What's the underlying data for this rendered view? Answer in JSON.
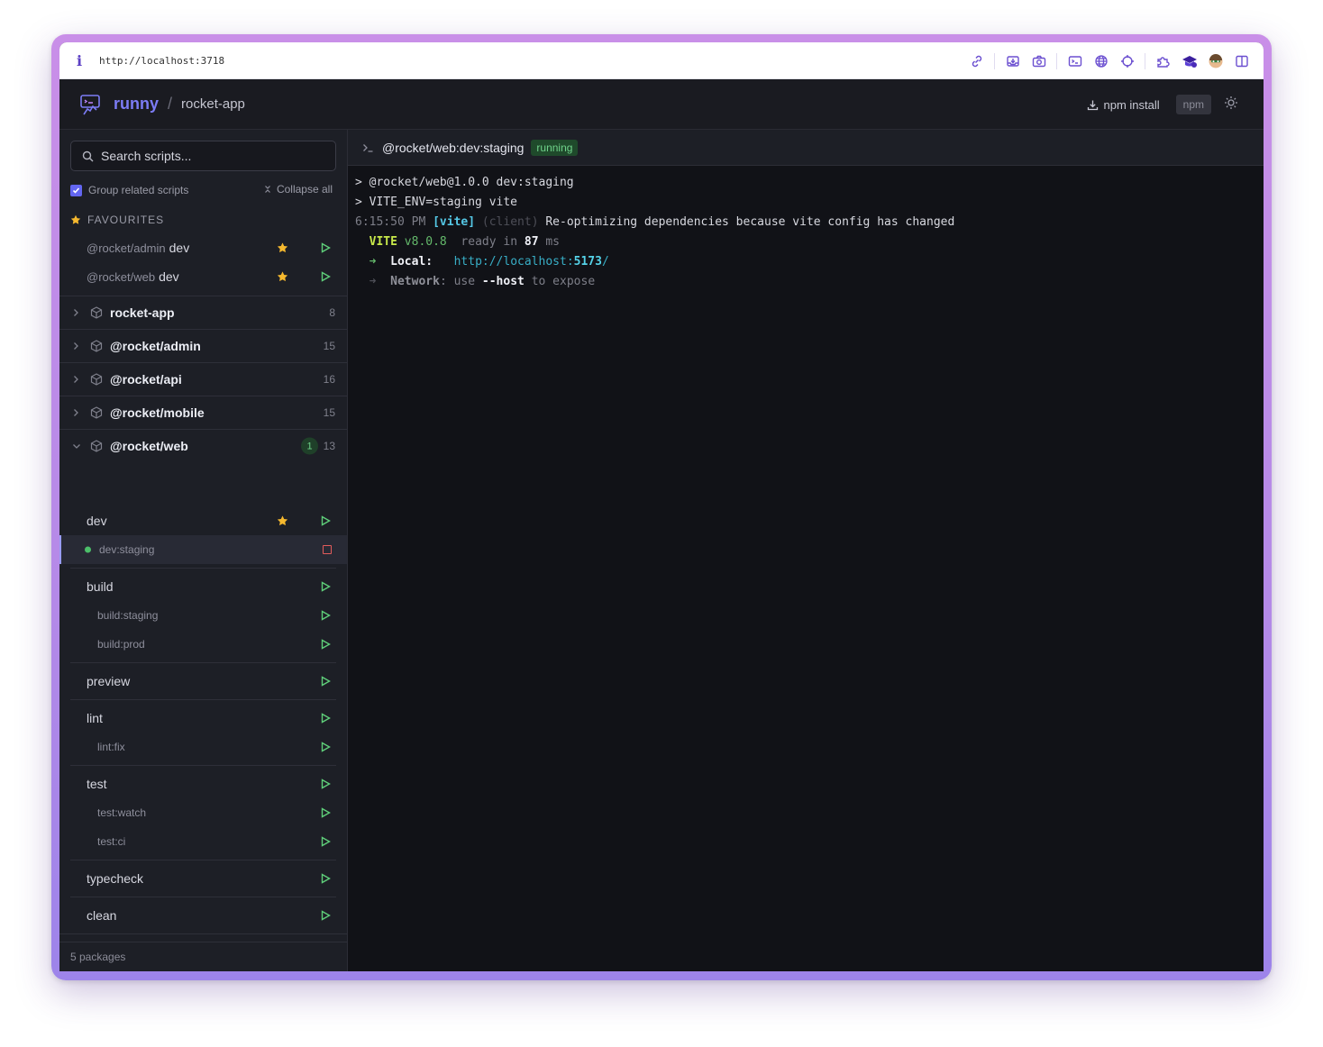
{
  "browser": {
    "url": "http://localhost:3718",
    "info_icon": "i",
    "toolbar_icons": [
      "link-icon",
      "inbox-download-icon",
      "camera-icon",
      "terminal-icon",
      "globe-icon",
      "crosshair-icon",
      "puzzle-icon",
      "graduation-icon",
      "avatar-icon",
      "sidebar-panel-icon"
    ]
  },
  "header": {
    "brand": "runny",
    "separator": "/",
    "project": "rocket-app",
    "install_label": "npm install",
    "package_manager": "npm"
  },
  "sidebar": {
    "search_placeholder": "Search scripts...",
    "group_label": "Group related scripts",
    "group_checked": true,
    "collapse_label": "Collapse all",
    "favourites_title": "FAVOURITES",
    "favourites": [
      {
        "package": "@rocket/admin",
        "script": "dev"
      },
      {
        "package": "@rocket/web",
        "script": "dev"
      }
    ],
    "packages": [
      {
        "name": "rocket-app",
        "count": "8"
      },
      {
        "name": "@rocket/admin",
        "count": "15"
      },
      {
        "name": "@rocket/api",
        "count": "16"
      },
      {
        "name": "@rocket/mobile",
        "count": "15"
      },
      {
        "name": "@rocket/web",
        "count": "13",
        "running": "1"
      }
    ],
    "web_scripts": {
      "dev": "dev",
      "dev_staging": "dev:staging",
      "build": "build",
      "build_staging": "build:staging",
      "build_prod": "build:prod",
      "preview": "preview",
      "lint": "lint",
      "lint_fix": "lint:fix",
      "test": "test",
      "test_watch": "test:watch",
      "test_ci": "test:ci",
      "typecheck": "typecheck",
      "clean": "clean"
    },
    "footer": "5 packages"
  },
  "terminal": {
    "title": "@rocket/web:dev:staging",
    "status": "running",
    "line1": "> @rocket/web@1.0.0 dev:staging",
    "line2": "> VITE_ENV=staging vite",
    "line3_time": "6:15:50 PM",
    "line3_tag": "[vite]",
    "line3_scope": "(client)",
    "line3_msg": "Re-optimizing dependencies because vite config has changed",
    "line4_vite": "VITE",
    "line4_version": "v8.0.8",
    "line4_ready": "ready in",
    "line4_ms_value": "87",
    "line4_ms_unit": "ms",
    "line5_arrow": "➜",
    "line5_label": "Local:",
    "line5_url_prefix": "http://localhost:",
    "line5_port": "5173",
    "line5_url_suffix": "/",
    "line6_arrow": "➜",
    "line6_label": "Network",
    "line6_colon": ":",
    "line6_use": "use",
    "line6_flag": "--host",
    "line6_expose": "to expose"
  },
  "colors": {
    "accent": "#6366f1",
    "brand": "#7c7cf5",
    "running": "#6fd28a",
    "star": "#f5b82e",
    "play": "#5fcf7a",
    "stop": "#e35b5b"
  }
}
